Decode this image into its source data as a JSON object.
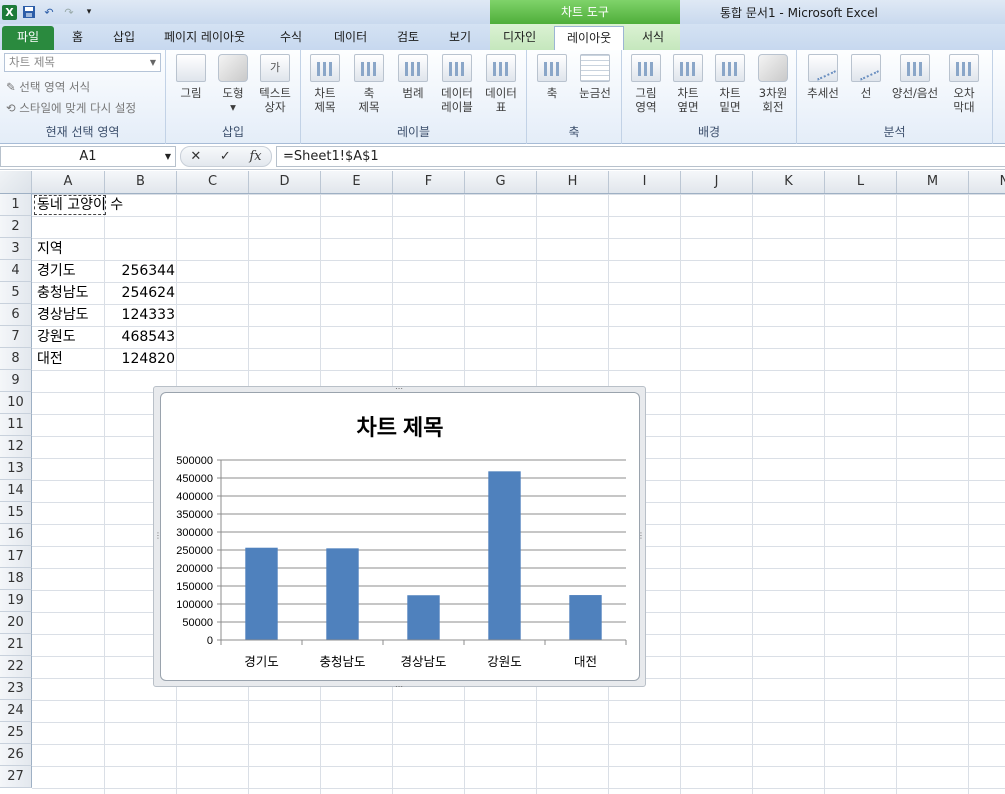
{
  "titlebar": {
    "contextual_tab": "차트 도구",
    "document_title": "통합 문서1  -  Microsoft Excel"
  },
  "tabs": {
    "file": "파일",
    "home": "홈",
    "insert": "삽입",
    "page_layout": "페이지 레이아웃",
    "formulas": "수식",
    "data": "데이터",
    "review": "검토",
    "view": "보기",
    "design": "디자인",
    "layout": "레이아웃",
    "format": "서식"
  },
  "ribbon": {
    "current_selection": {
      "combo_value": "차트 제목",
      "format_selection": "선택 영역 서식",
      "reset_style": "스타일에 맞게 다시 설정",
      "label": "현재 선택 영역"
    },
    "insert": {
      "picture": "그림",
      "shapes": "도형",
      "textbox_1": "텍스트",
      "textbox_2": "상자",
      "label": "삽입",
      "textbox_icon": "가"
    },
    "labels": {
      "chart_title_1": "차트",
      "chart_title_2": "제목",
      "axis_titles_1": "축",
      "axis_titles_2": "제목",
      "legend": "범례",
      "data_labels_1": "데이터",
      "data_labels_2": "레이블",
      "data_table_1": "데이터",
      "data_table_2": "표",
      "label": "레이블"
    },
    "axes": {
      "axes": "축",
      "gridlines": "눈금선",
      "label": "축"
    },
    "background": {
      "plot_area_1": "그림",
      "plot_area_2": "영역",
      "chart_wall_1": "차트",
      "chart_wall_2": "옆면",
      "chart_floor_1": "차트",
      "chart_floor_2": "밑면",
      "rotation_1": "3차원",
      "rotation_2": "회전",
      "label": "배경"
    },
    "analysis": {
      "trendline": "추세선",
      "lines": "선",
      "updown_bars": "양선/음선",
      "error_bars_1": "오차",
      "error_bars_2": "막대",
      "label": "분석"
    }
  },
  "formula_bar": {
    "name_box": "A1",
    "formula": "=Sheet1!$A$1",
    "cancel": "✕",
    "enter": "✓",
    "fx": "fx"
  },
  "sheet": {
    "columns": [
      "A",
      "B",
      "C",
      "D",
      "E",
      "F",
      "G",
      "H",
      "I",
      "J",
      "K",
      "L",
      "M",
      "N"
    ],
    "rows": [
      "1",
      "2",
      "3",
      "4",
      "5",
      "6",
      "7",
      "8",
      "9",
      "10",
      "11",
      "12",
      "13",
      "14",
      "15",
      "16",
      "17",
      "18",
      "19",
      "20",
      "21",
      "22",
      "23",
      "24",
      "25",
      "26",
      "27"
    ],
    "a1": "동네 고양이 수",
    "a3": "지역",
    "data_rows": [
      {
        "region": "경기도",
        "value": "256344"
      },
      {
        "region": "충청남도",
        "value": "254624"
      },
      {
        "region": "경상남도",
        "value": "124333"
      },
      {
        "region": "강원도",
        "value": "468543"
      },
      {
        "region": "대전",
        "value": "124820"
      }
    ]
  },
  "colors": {
    "bar": "#4f81bd",
    "file_tab": "#2a8a3e",
    "chart_tools": "#5cb548"
  },
  "chart_data": {
    "type": "bar",
    "title": "차트 제목",
    "categories": [
      "경기도",
      "충청남도",
      "경상남도",
      "강원도",
      "대전"
    ],
    "values": [
      256344,
      254624,
      124333,
      468543,
      124820
    ],
    "ylim": [
      0,
      500000
    ],
    "yticks": [
      "0",
      "50000",
      "100000",
      "150000",
      "200000",
      "250000",
      "300000",
      "350000",
      "400000",
      "450000",
      "500000"
    ],
    "grid": true,
    "legend": "none"
  }
}
